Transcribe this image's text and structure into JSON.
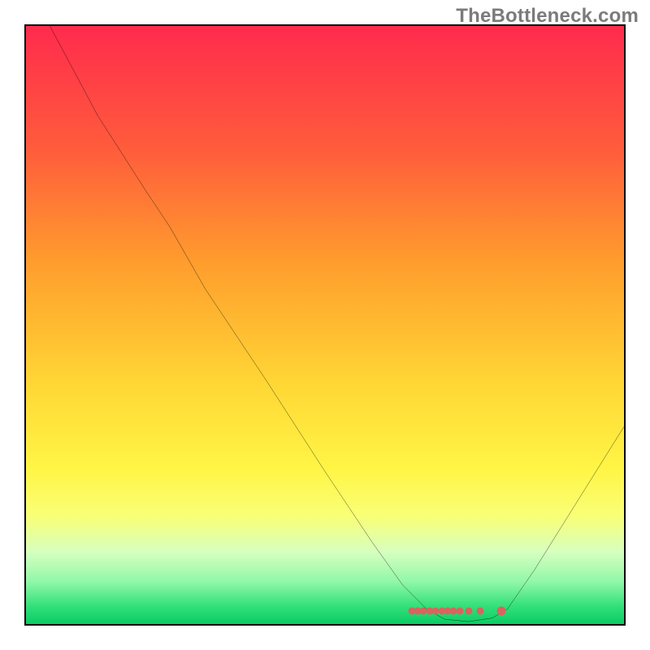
{
  "watermark": "TheBottleneck.com",
  "chart_data": {
    "type": "line",
    "title": "",
    "xlabel": "",
    "ylabel": "",
    "xlim": [
      0,
      100
    ],
    "ylim": [
      0,
      100
    ],
    "grid": false,
    "legend": false,
    "gradient_stops": [
      {
        "offset": 0.0,
        "color": "#ff2b4d"
      },
      {
        "offset": 0.2,
        "color": "#ff5a3c"
      },
      {
        "offset": 0.4,
        "color": "#ff9e2d"
      },
      {
        "offset": 0.6,
        "color": "#ffd735"
      },
      {
        "offset": 0.74,
        "color": "#fff545"
      },
      {
        "offset": 0.82,
        "color": "#f9ff77"
      },
      {
        "offset": 0.88,
        "color": "#d6ffbf"
      },
      {
        "offset": 0.93,
        "color": "#8ff7a8"
      },
      {
        "offset": 0.97,
        "color": "#33e07a"
      },
      {
        "offset": 1.0,
        "color": "#0acc64"
      }
    ],
    "series": [
      {
        "name": "curve",
        "points": [
          {
            "x": 4.0,
            "y": 100.0
          },
          {
            "x": 12.0,
            "y": 85.0
          },
          {
            "x": 20.0,
            "y": 72.5
          },
          {
            "x": 24.0,
            "y": 66.5
          },
          {
            "x": 30.0,
            "y": 56.0
          },
          {
            "x": 40.0,
            "y": 41.0
          },
          {
            "x": 50.0,
            "y": 25.5
          },
          {
            "x": 58.0,
            "y": 13.5
          },
          {
            "x": 63.0,
            "y": 6.5
          },
          {
            "x": 67.0,
            "y": 2.5
          },
          {
            "x": 70.0,
            "y": 0.8
          },
          {
            "x": 74.0,
            "y": 0.4
          },
          {
            "x": 78.0,
            "y": 1.0
          },
          {
            "x": 80.5,
            "y": 2.5
          },
          {
            "x": 85.0,
            "y": 9.0
          },
          {
            "x": 90.0,
            "y": 17.0
          },
          {
            "x": 95.0,
            "y": 25.0
          },
          {
            "x": 100.0,
            "y": 33.0
          }
        ]
      }
    ],
    "scatter": {
      "name": "markers",
      "y": 2.2,
      "x": [
        64.5,
        65.5,
        66.5,
        67.5,
        68.5,
        69.5,
        70.5,
        71.5,
        72.5,
        74.0,
        76.0,
        79.5
      ],
      "last_big": true
    }
  }
}
